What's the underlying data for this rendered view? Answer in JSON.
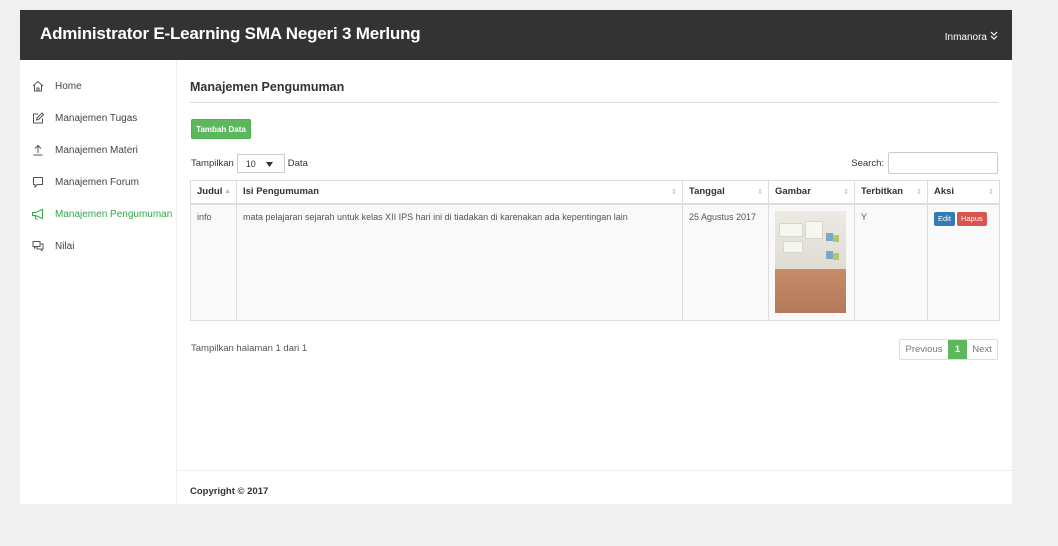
{
  "header": {
    "title": "Administrator E-Learning SMA Negeri 3 Merlung",
    "user": "Inmanora",
    "user_icon": "double-chevron-down-icon"
  },
  "sidebar": {
    "items": [
      {
        "label": "Home",
        "icon": "home-icon"
      },
      {
        "label": "Manajemen Tugas",
        "icon": "edit-icon"
      },
      {
        "label": "Manajemen Materi",
        "icon": "upload-icon"
      },
      {
        "label": "Manajemen Forum",
        "icon": "comment-icon"
      },
      {
        "label": "Manajemen Pengumuman",
        "icon": "megaphone-icon"
      },
      {
        "label": "Nilai",
        "icon": "comments-icon"
      }
    ],
    "active_color": "#2fa84a"
  },
  "main": {
    "title": "Manajemen Pengumuman",
    "add_button": "Tambah Data",
    "length_label_pre": "Tampilkan",
    "length_value": "10",
    "length_label_post": "Data",
    "search_label": "Search:",
    "search_value": "",
    "table": {
      "headers": [
        "Judul",
        "Isi Pengumuman",
        "Tanggal",
        "Gambar",
        "Terbitkan",
        "Aksi"
      ],
      "rows": [
        {
          "judul": "info",
          "isi": "mata pelajaran  sejarah untuk kelas XII IPS hari ini di tiadakan di karenakan ada kepentingan lain",
          "tanggal": "25 Agustus 2017",
          "terbitkan": "Y",
          "edit": "Edit",
          "hapus": "Hapus"
        }
      ]
    },
    "info": "Tampilkan halaman 1 dari 1",
    "pagination": {
      "previous": "Previous",
      "current": "1",
      "next": "Next"
    },
    "footer": "Copyright © 2017"
  },
  "colors": {
    "topbar": "#333333",
    "primary": "#5cb85c",
    "edit": "#337ab7",
    "delete": "#d9534f"
  }
}
